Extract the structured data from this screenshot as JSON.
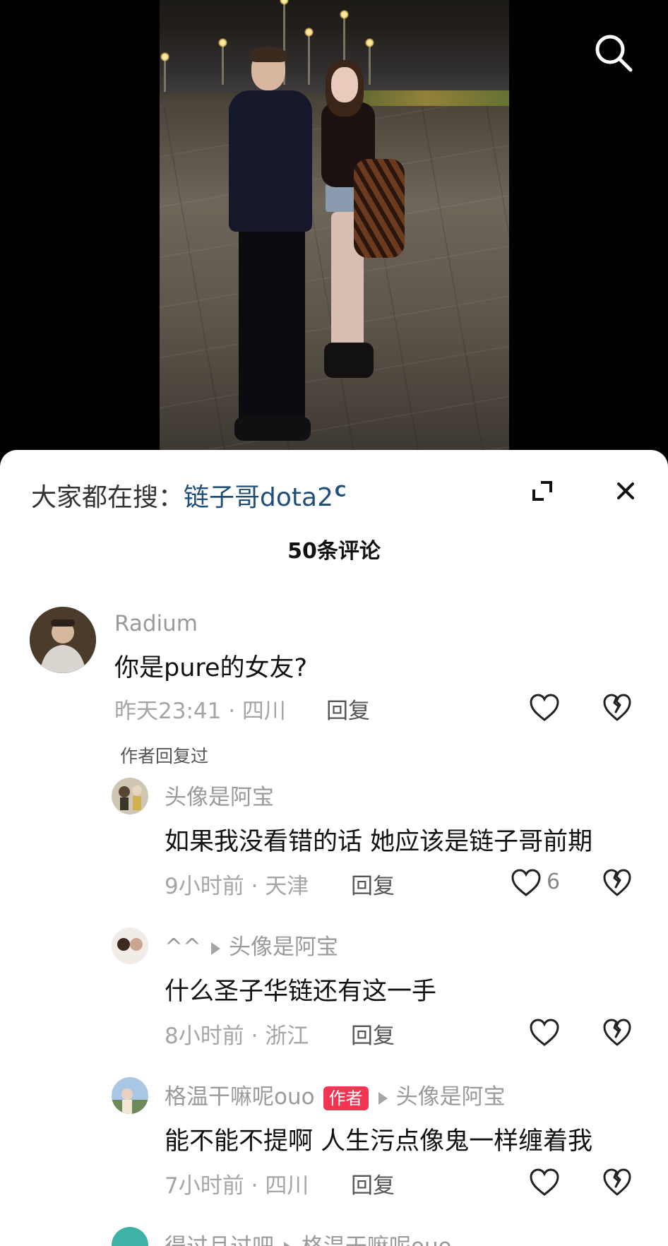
{
  "video": {
    "search_icon": "search-icon"
  },
  "sheet": {
    "suggest_prefix": "大家都在搜：",
    "suggest_keyword": "链子哥dota2",
    "count_title": "50条评论",
    "icons": {
      "expand": "expand-icon",
      "close": "close-icon"
    }
  },
  "comments": [
    {
      "username": "Radium",
      "text": "你是pure的女友?",
      "time": "昨天23:41",
      "sep": "·",
      "location": "四川",
      "reply_label": "回复",
      "likes": "",
      "author_replied": "作者回复过"
    },
    {
      "username": "头像是阿宝",
      "text": "如果我没看错的话 她应该是链子哥前期",
      "time": "9小时前",
      "sep": "·",
      "location": "天津",
      "reply_label": "回复",
      "likes": "6"
    },
    {
      "username": "^^",
      "reply_to": "头像是阿宝",
      "text": "什么圣子华链还有这一手",
      "time": "8小时前",
      "sep": "·",
      "location": "浙江",
      "reply_label": "回复",
      "likes": ""
    },
    {
      "username": "格温干嘛呢ouo",
      "badge": "作者",
      "reply_to": "头像是阿宝",
      "text": "能不能不提啊 人生污点像鬼一样缠着我",
      "time": "7小时前",
      "sep": "·",
      "location": "四川",
      "reply_label": "回复",
      "likes": ""
    },
    {
      "username": "得过且过吧",
      "reply_to": "格温干嘛呢ouo"
    }
  ],
  "colors": {
    "keyword": "#1f4e79",
    "author_badge": "#f23553",
    "muted": "#a5a5a5"
  }
}
